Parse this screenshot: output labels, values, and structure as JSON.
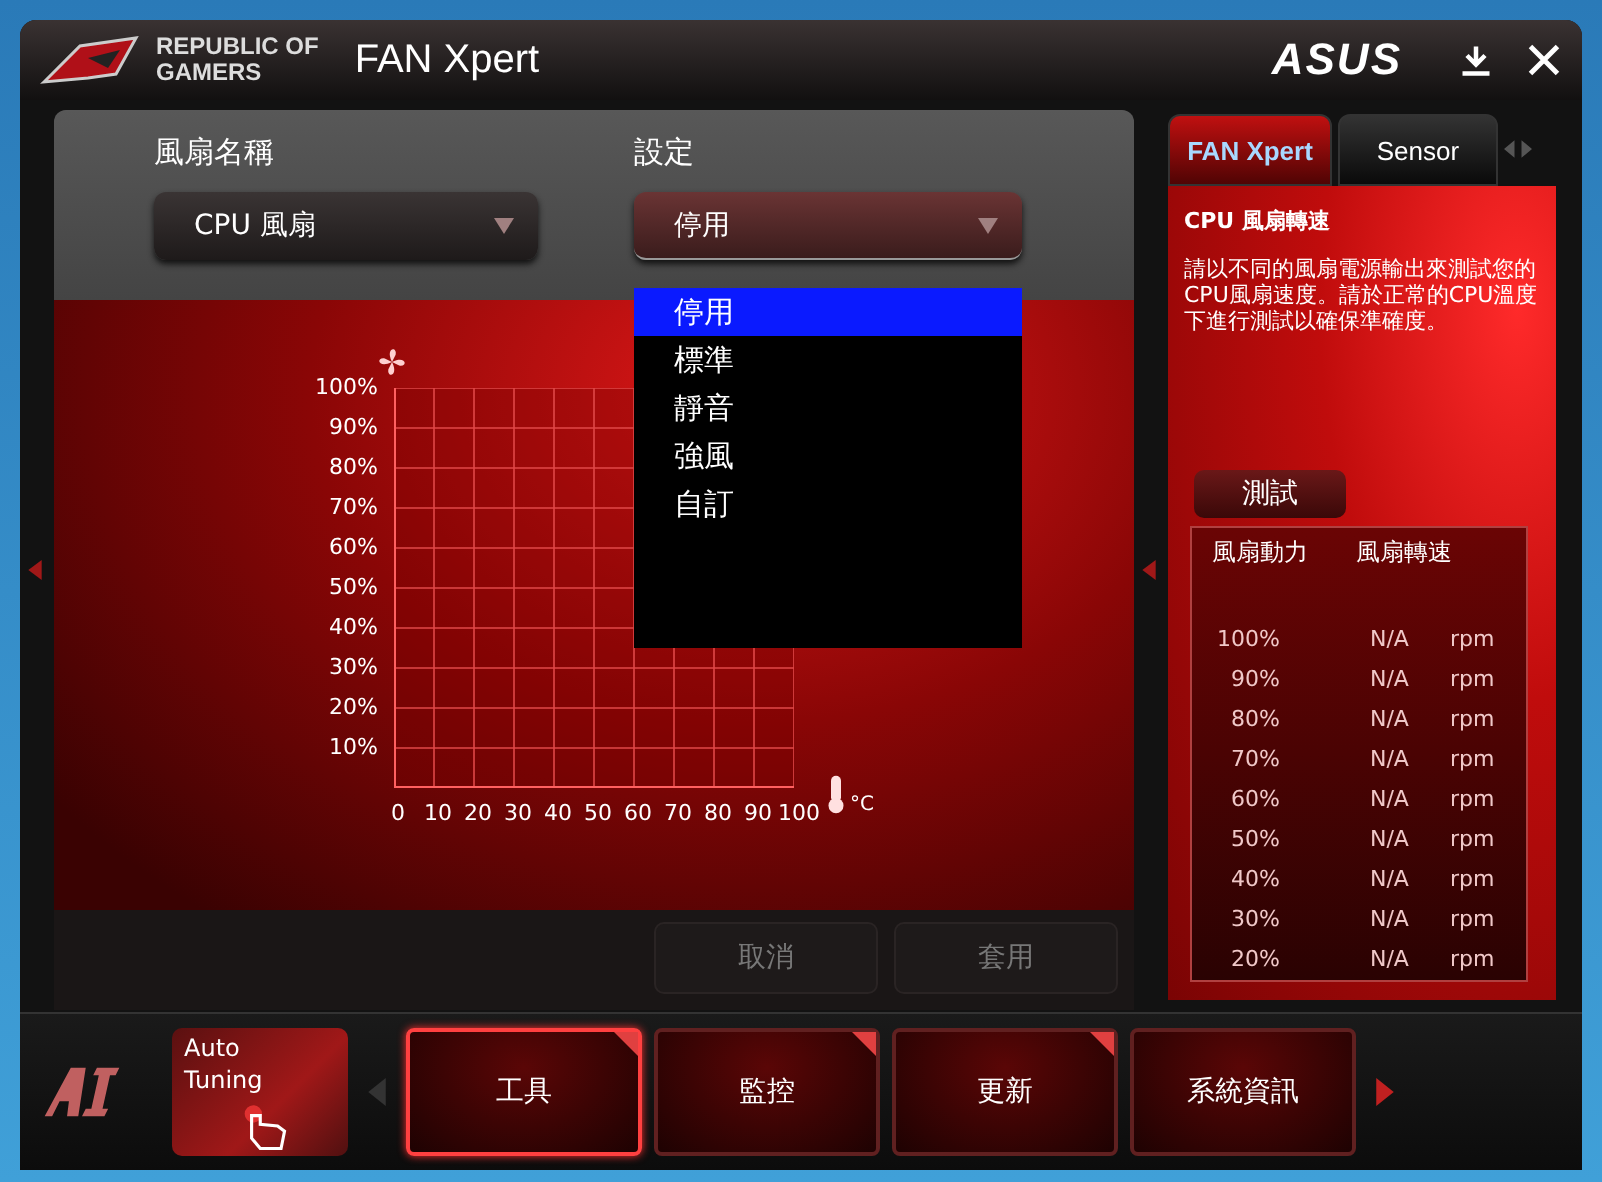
{
  "window": {
    "logo_line1": "REPUBLIC OF",
    "logo_line2": "GAMERS",
    "title": "FAN Xpert",
    "brand": "ASUS"
  },
  "fan_name": {
    "label": "風扇名稱",
    "value": "CPU 風扇"
  },
  "setting": {
    "label": "設定",
    "value": "停用",
    "expanded": true,
    "options": [
      {
        "label": "停用",
        "selected": true
      },
      {
        "label": "標準",
        "selected": false
      },
      {
        "label": "靜音",
        "selected": false
      },
      {
        "label": "強風",
        "selected": false
      },
      {
        "label": "自訂",
        "selected": false
      }
    ]
  },
  "chart": {
    "y_labels": [
      "100%",
      "90%",
      "80%",
      "70%",
      "60%",
      "50%",
      "40%",
      "30%",
      "20%",
      "10%"
    ],
    "x_labels": [
      "0",
      "10",
      "20",
      "30",
      "40",
      "50",
      "60",
      "70",
      "80",
      "90",
      "100"
    ],
    "unit": "°C"
  },
  "buttons": [
    {
      "label": "取消",
      "disabled": true
    },
    {
      "label": "套用",
      "disabled": true
    }
  ],
  "tabs": [
    {
      "label": "FAN Xpert",
      "selected": true
    },
    {
      "label": "Sensor",
      "selected": false
    }
  ],
  "info": {
    "title": "CPU 風扇轉速",
    "text": "請以不同的風扇電源輸出來測試您的CPU風扇速度。請於正常的CPU溫度下進行測試以確保準確度。"
  },
  "test_button": "測試",
  "table": {
    "columns": [
      "風扇動力",
      "風扇轉速"
    ],
    "rows": [
      {
        "power": "100%",
        "speed": "N/A",
        "unit": "rpm"
      },
      {
        "power": "90%",
        "speed": "N/A",
        "unit": "rpm"
      },
      {
        "power": "80%",
        "speed": "N/A",
        "unit": "rpm"
      },
      {
        "power": "70%",
        "speed": "N/A",
        "unit": "rpm"
      },
      {
        "power": "60%",
        "speed": "N/A",
        "unit": "rpm"
      },
      {
        "power": "50%",
        "speed": "N/A",
        "unit": "rpm"
      },
      {
        "power": "40%",
        "speed": "N/A",
        "unit": "rpm"
      },
      {
        "power": "30%",
        "speed": "N/A",
        "unit": "rpm"
      },
      {
        "power": "20%",
        "speed": "N/A",
        "unit": "rpm"
      }
    ]
  },
  "auto_tuning": "Auto Tuning",
  "nav": [
    {
      "label": "工具",
      "selected": true
    },
    {
      "label": "監控",
      "selected": false
    },
    {
      "label": "更新",
      "selected": false
    },
    {
      "label": "系統資訊",
      "selected": false
    }
  ]
}
